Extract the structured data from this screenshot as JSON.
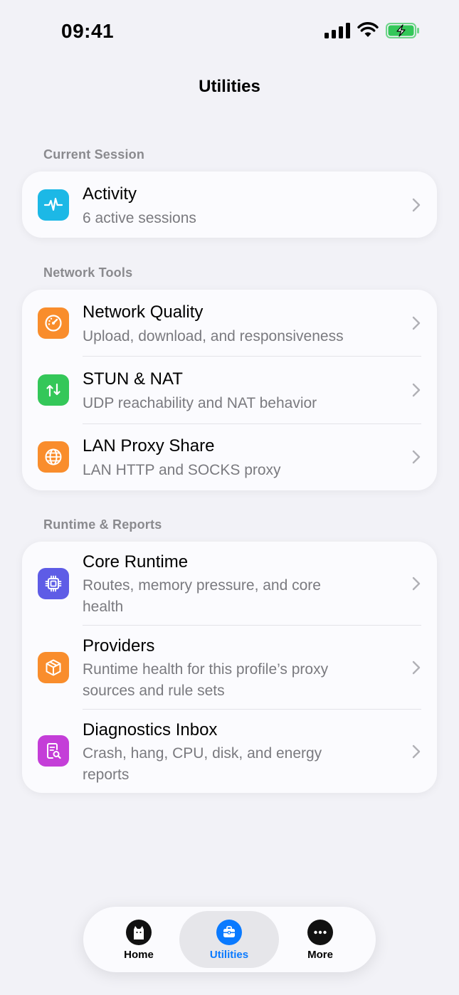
{
  "status_bar": {
    "time": "09:41"
  },
  "nav": {
    "title": "Utilities"
  },
  "sections": {
    "current_session": {
      "header": "Current Session",
      "activity": {
        "title": "Activity",
        "subtitle": "6 active sessions"
      }
    },
    "network_tools": {
      "header": "Network Tools",
      "network_quality": {
        "title": "Network Quality",
        "subtitle": "Upload, download, and responsiveness"
      },
      "stun_nat": {
        "title": "STUN & NAT",
        "subtitle": "UDP reachability and NAT behavior"
      },
      "lan_proxy": {
        "title": "LAN Proxy Share",
        "subtitle": "LAN HTTP and SOCKS proxy"
      }
    },
    "runtime_reports": {
      "header": "Runtime & Reports",
      "core_runtime": {
        "title": "Core Runtime",
        "subtitle": "Routes, memory pressure, and core health"
      },
      "providers": {
        "title": "Providers",
        "subtitle": "Runtime health for this profile’s proxy sources and rule sets"
      },
      "diagnostics": {
        "title": "Diagnostics Inbox",
        "subtitle": "Crash, hang, CPU, disk, and energy reports"
      }
    }
  },
  "tabbar": {
    "home": "Home",
    "utilities": "Utilities",
    "more": "More"
  },
  "colors": {
    "accent": "#0a7aff",
    "activity_icon": "#1cb8e6",
    "network_quality_icon": "#f98d2c",
    "stun_icon": "#34c759",
    "lan_proxy_icon": "#f98d2c",
    "core_runtime_icon": "#5e5ce6",
    "providers_icon": "#f98d2c",
    "diagnostics_icon": "#c43ed8"
  },
  "icons": {
    "activity": "waveform-icon",
    "network_quality": "speedometer-icon",
    "stun_nat": "arrows-updown-icon",
    "lan_proxy": "globe-icon",
    "core_runtime": "cpu-icon",
    "providers": "box-icon",
    "diagnostics": "report-search-icon"
  }
}
